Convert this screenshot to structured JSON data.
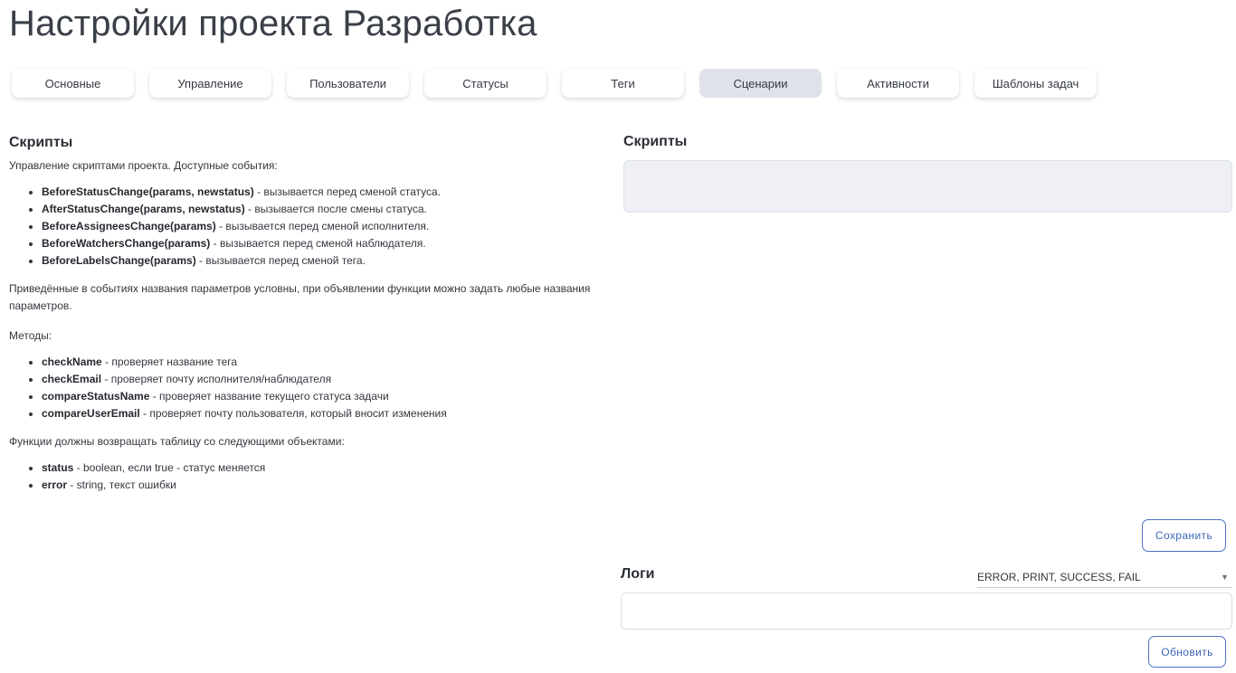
{
  "page": {
    "title": "Настройки проекта Разработка"
  },
  "tabs": [
    {
      "label": "Основные",
      "active": false
    },
    {
      "label": "Управление",
      "active": false
    },
    {
      "label": "Пользователи",
      "active": false
    },
    {
      "label": "Статусы",
      "active": false
    },
    {
      "label": "Теги",
      "active": false
    },
    {
      "label": "Сценарии",
      "active": true
    },
    {
      "label": "Активности",
      "active": false
    },
    {
      "label": "Шаблоны задач",
      "active": false
    }
  ],
  "docs": {
    "heading": "Скрипты",
    "intro": "Управление скриптами проекта. Доступные события:",
    "events": [
      {
        "name": "BeforeStatusChange(params, newstatus)",
        "desc": " - вызывается перед сменой статуса."
      },
      {
        "name": "AfterStatusChange(params, newstatus)",
        "desc": " - вызывается после смены статуса."
      },
      {
        "name": "BeforeAssigneesChange(params)",
        "desc": " - вызывается перед сменой исполнителя."
      },
      {
        "name": "BeforeWatchersChange(params)",
        "desc": " - вызывается перед сменой наблюдателя."
      },
      {
        "name": "BeforeLabelsChange(params)",
        "desc": " - вызывается перед сменой тега."
      }
    ],
    "params_note": "Приведённые в событиях названия параметров условны, при объявлении функции можно задать любые названия параметров.",
    "methods_heading": "Методы:",
    "methods": [
      {
        "name": "checkName",
        "desc": " - проверяет название тега"
      },
      {
        "name": "checkEmail",
        "desc": " - проверяет почту исполнителя/наблюдателя"
      },
      {
        "name": "compareStatusName",
        "desc": " - проверяет название текущего статуса задачи"
      },
      {
        "name": "compareUserEmail",
        "desc": " - проверяет почту пользователя, который вносит изменения"
      }
    ],
    "return_heading": "Функции должны возвращать таблицу со следующими объектами:",
    "returns": [
      {
        "name": "status",
        "desc": " - boolean, если true - статус меняется"
      },
      {
        "name": "error",
        "desc": " - string, текст ошибки"
      }
    ]
  },
  "editor": {
    "title": "Скрипты",
    "content": "",
    "save_label": "Сохранить"
  },
  "logs": {
    "title": "Логи",
    "filter_value": "ERROR, PRINT, SUCCESS, FAIL",
    "content": "",
    "refresh_label": "Обновить"
  },
  "icons": {
    "filter_caret": "chevron-down-icon"
  },
  "colors": {
    "accent": "#4a72c4",
    "active_tab": "#dfe2ea",
    "editor_bg": "#eef0f6"
  }
}
